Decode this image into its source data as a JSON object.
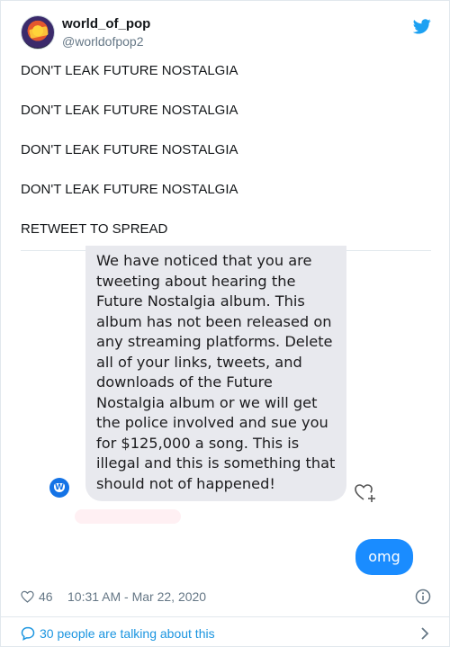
{
  "author": {
    "display_name": "world_of_pop",
    "username": "@worldofpop2"
  },
  "tweet": {
    "lines": [
      "DON'T LEAK FUTURE NOSTALGIA",
      "DON'T LEAK FUTURE NOSTALGIA",
      "DON'T LEAK FUTURE NOSTALGIA",
      "DON'T LEAK FUTURE NOSTALGIA",
      "RETWEET TO SPREAD"
    ]
  },
  "media": {
    "received_lines": [
      "We have noticed that you are",
      "tweeting about hearing the",
      "Future Nostalgia album. This",
      "album has not been released on",
      "any streaming platforms. Delete",
      "all of your links, tweets, and",
      "downloads of the Future",
      "Nostalgia album or we will get",
      "the police involved and sue you",
      "for $125,000 a song. This is",
      "illegal and this is something that",
      "should not of happened!"
    ],
    "sent_message": "omg"
  },
  "meta": {
    "like_count": "46",
    "timestamp": "10:31 AM - Mar 22, 2020"
  },
  "footer": {
    "conversation_text": "30 people are talking about this"
  },
  "colors": {
    "brand_blue": "#1da1f2",
    "imessage_blue": "#1a8cff",
    "bubble_grey": "#e8e9ee",
    "link_blue": "#1b95e0"
  }
}
